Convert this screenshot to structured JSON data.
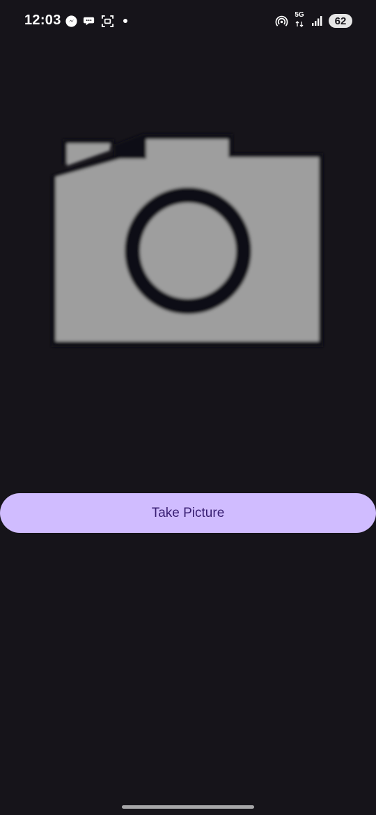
{
  "status_bar": {
    "time": "12:03",
    "left_icons": [
      "messenger-icon",
      "chat-bubble-icon",
      "screenshot-icon",
      "dot-icon"
    ],
    "right_icons": [
      "hotspot-icon",
      "5g-data-icon",
      "signal-icon"
    ],
    "network_label": "5G",
    "battery_level": "62"
  },
  "main": {
    "image_icon": "camera-icon",
    "image_colors": {
      "body": "#9e9e9e",
      "outline": "#101014"
    },
    "take_picture_label": "Take Picture"
  },
  "theme": {
    "background": "#16141a",
    "button_background": "#d0bcff",
    "button_text": "#381e72"
  }
}
